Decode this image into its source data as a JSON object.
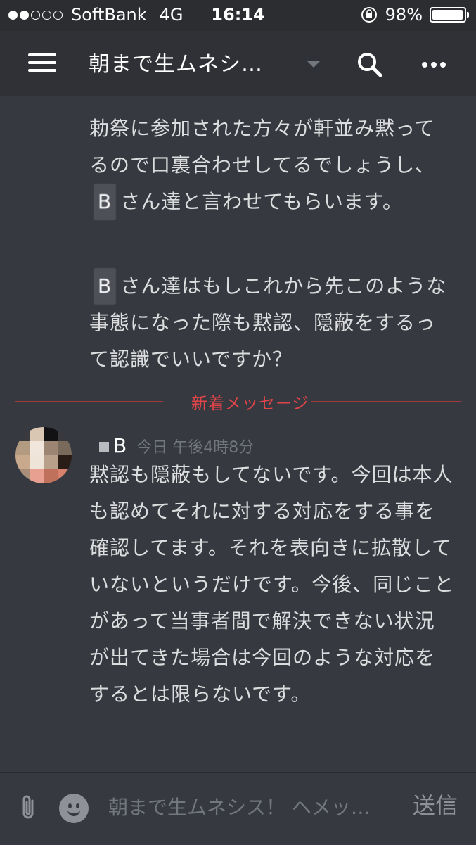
{
  "status_bar": {
    "carrier": "SoftBank",
    "network": "4G",
    "time": "16:14",
    "battery": "98%",
    "battery_level": 0.98,
    "signal_bars": 2,
    "signal_total": 5
  },
  "app_bar": {
    "channel_title": "朝まで生ムネシ…",
    "icons": [
      "hamburger-menu-icon",
      "dropdown-icon",
      "search-icon",
      "more-icon"
    ]
  },
  "messages": {
    "earlier": [
      {
        "before": "勅祭に参加された方々が軒並み黙ってるので口裏合わせしてるでしょうし、",
        "mention": "B",
        "after": "さん達と言わせてもらいます。"
      },
      {
        "before": "",
        "mention": "B",
        "after": "さん達はもしこれから先このような事態になった際も黙認、隠蔽をするって認識でいいですか？"
      }
    ],
    "divider_label": "新着メッセージ",
    "new_message": {
      "author": "B",
      "timestamp": "今日 午後4時8分",
      "text": "黙認も隠蔽もしてないです。今回は本人も認めてそれに対する対応をする事を確認してます。それを表向きに拡散していないというだけです。今後、同じことがあって当事者間で解決できない状況が出てきた場合は今回のような対応をするとは限らないです。"
    }
  },
  "composer": {
    "placeholder": "朝まで生ムネシス！ ヘメッ…",
    "send_label": "送信",
    "icons": [
      "paperclip-icon",
      "emoji-icon"
    ]
  },
  "colors": {
    "background": "#36393f",
    "header": "#2f3136",
    "divider": "#e0454a",
    "text": "#dcddde"
  }
}
